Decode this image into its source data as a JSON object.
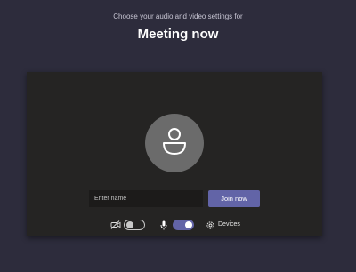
{
  "header": {
    "subtitle": "Choose your audio and video settings for",
    "title": "Meeting now"
  },
  "preview": {
    "avatar_icon": "person-icon",
    "name_input": {
      "placeholder": "Enter name",
      "value": ""
    },
    "join_label": "Join now"
  },
  "controls": {
    "camera": {
      "icon": "camera-off-icon",
      "state": "off"
    },
    "microphone": {
      "icon": "microphone-icon",
      "state": "on"
    },
    "devices": {
      "icon": "gear-icon",
      "label": "Devices"
    }
  },
  "colors": {
    "background": "#2d2c3c",
    "panel": "#252423",
    "accent": "#6264a7"
  }
}
